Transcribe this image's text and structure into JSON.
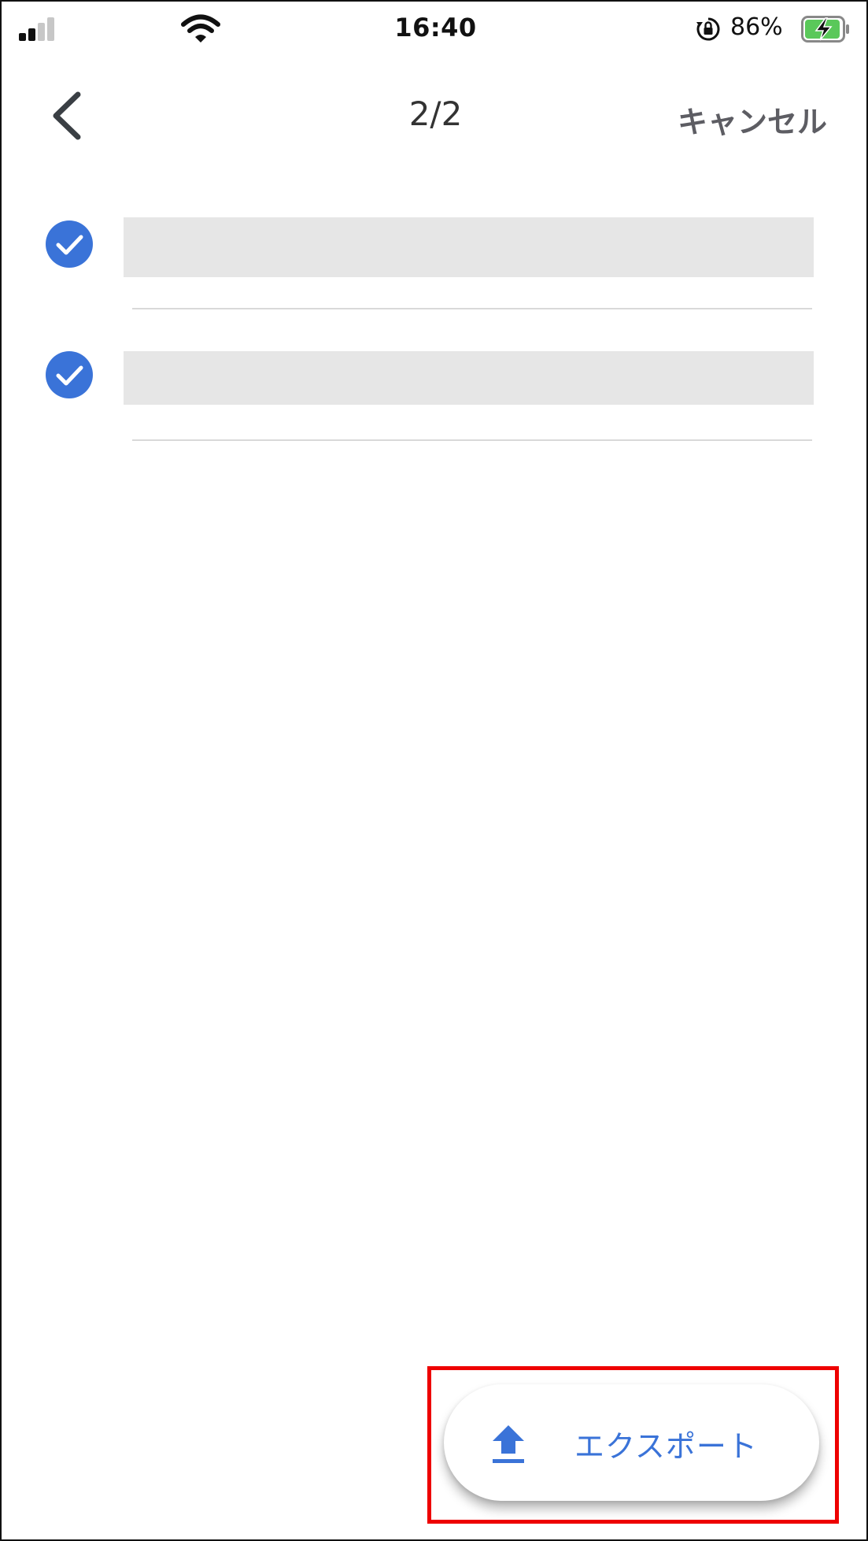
{
  "status_bar": {
    "time": "16:40",
    "battery_percent": "86%",
    "signal_icon": "cellular-signal-icon",
    "wifi_icon": "wifi-icon",
    "rotation_lock_icon": "rotation-lock-icon",
    "battery_icon": "battery-charging-icon"
  },
  "nav": {
    "back_icon": "chevron-left-icon",
    "title": "2/2",
    "cancel_label": "キャンセル"
  },
  "items": [
    {
      "checked": true,
      "icon": "check-circle-icon"
    },
    {
      "checked": true,
      "icon": "check-circle-icon"
    }
  ],
  "export_button": {
    "icon": "upload-icon",
    "label": "エクスポート"
  },
  "colors": {
    "accent": "#3a73d8",
    "highlight": "#ee0000",
    "battery_fill": "#5ac85a",
    "placeholder": "#e6e6e6"
  }
}
